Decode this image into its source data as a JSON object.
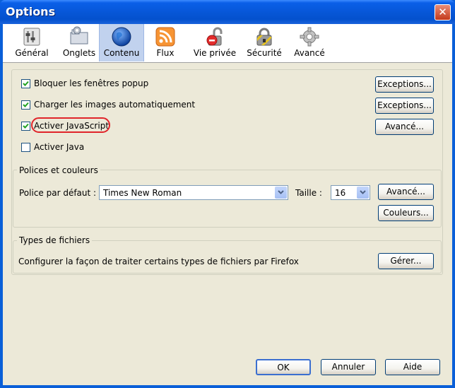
{
  "window": {
    "title": "Options",
    "close_label": "✕"
  },
  "toolbar": {
    "items": [
      {
        "label": "Général",
        "icon": "general-icon"
      },
      {
        "label": "Onglets",
        "icon": "tabs-icon"
      },
      {
        "label": "Contenu",
        "icon": "globe-icon",
        "selected": true
      },
      {
        "label": "Flux",
        "icon": "rss-icon"
      },
      {
        "label": "Vie privée",
        "icon": "privacy-icon"
      },
      {
        "label": "Sécurité",
        "icon": "lock-icon"
      },
      {
        "label": "Avancé",
        "icon": "gear-icon"
      }
    ]
  },
  "content": {
    "popup": {
      "label": "Bloquer les fenêtres popup",
      "checked": true,
      "button": "Exceptions..."
    },
    "images": {
      "label": "Charger les images automatiquement",
      "checked": true,
      "button": "Exceptions..."
    },
    "javascript": {
      "label": "Activer JavaScript",
      "checked": true,
      "button": "Avancé..."
    },
    "java": {
      "label": "Activer Java",
      "checked": false
    }
  },
  "fonts": {
    "group_label": "Polices et couleurs",
    "default_font_label": "Police par défaut :",
    "default_font_value": "Times New Roman",
    "size_label": "Taille :",
    "size_value": "16",
    "advanced_button": "Avancé...",
    "colors_button": "Couleurs..."
  },
  "filetypes": {
    "group_label": "Types de fichiers",
    "description": "Configurer la façon de traiter certains types de fichiers par Firefox",
    "manage_button": "Gérer..."
  },
  "footer": {
    "ok": "OK",
    "cancel": "Annuler",
    "help": "Aide"
  },
  "colors": {
    "titlebar": "#0757d8",
    "dialog_bg": "#ece9d8",
    "selected_tab": "#c1d2ee",
    "highlight": "#e0242a"
  }
}
